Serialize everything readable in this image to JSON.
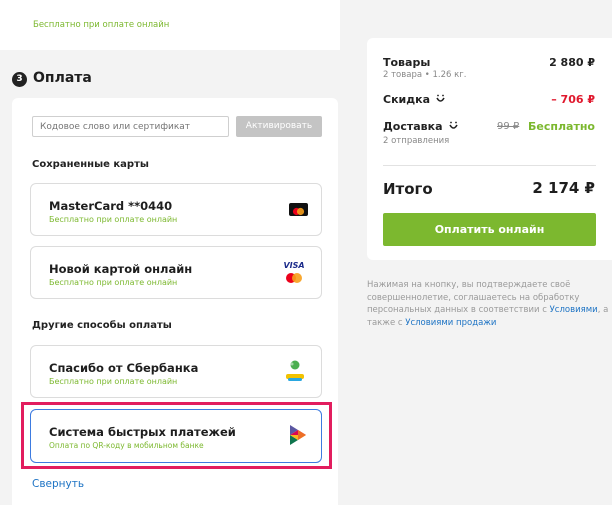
{
  "top_note": "Бесплатно при оплате онлайн",
  "payment": {
    "step_number": "3",
    "title": "Оплата",
    "promo_placeholder": "Кодовое слово или сертификат",
    "activate_label": "Активировать",
    "saved_cards_title": "Сохраненные карты",
    "saved_card": {
      "title": "MasterCard **0440",
      "subtitle": "Бесплатно при оплате онлайн"
    },
    "new_card": {
      "title": "Новой картой онлайн",
      "subtitle": "Бесплатно при оплате онлайн",
      "visa_text": "VISA"
    },
    "other_methods_title": "Другие способы оплаты",
    "sber": {
      "title": "Спасибо от Сбербанка",
      "subtitle": "Бесплатно при оплате онлайн"
    },
    "sbp": {
      "title": "Система быстрых платежей",
      "subtitle": "Оплата по QR-коду в мобильном банке"
    },
    "collapse_label": "Свернуть"
  },
  "summary": {
    "goods_label": "Товары",
    "goods_sub": "2 товара • 1.26 кг.",
    "goods_value": "2 880 ₽",
    "discount_label": "Скидка",
    "discount_value": "– 706 ₽",
    "delivery_label": "Доставка",
    "delivery_sub": "2 отправления",
    "delivery_old": "99 ₽",
    "delivery_value": "Бесплатно",
    "total_label": "Итого",
    "total_value": "2 174 ₽",
    "pay_button": "Оплатить онлайн"
  },
  "disclaimer": {
    "text_1": "Нажимая на кнопку, вы подтверждаете своё совершеннолетие, соглашаетесь на обработку персональных данных в соответствии с ",
    "link_1": "Условиями",
    "text_2": ", а также с ",
    "link_2": "Условиями продажи"
  },
  "colors": {
    "accent_green": "#7cb82f",
    "discount_red": "#e0182d",
    "highlight_pink": "#e21d5e",
    "link_blue": "#1d73c4",
    "sbp_border": "#3d7be0"
  }
}
